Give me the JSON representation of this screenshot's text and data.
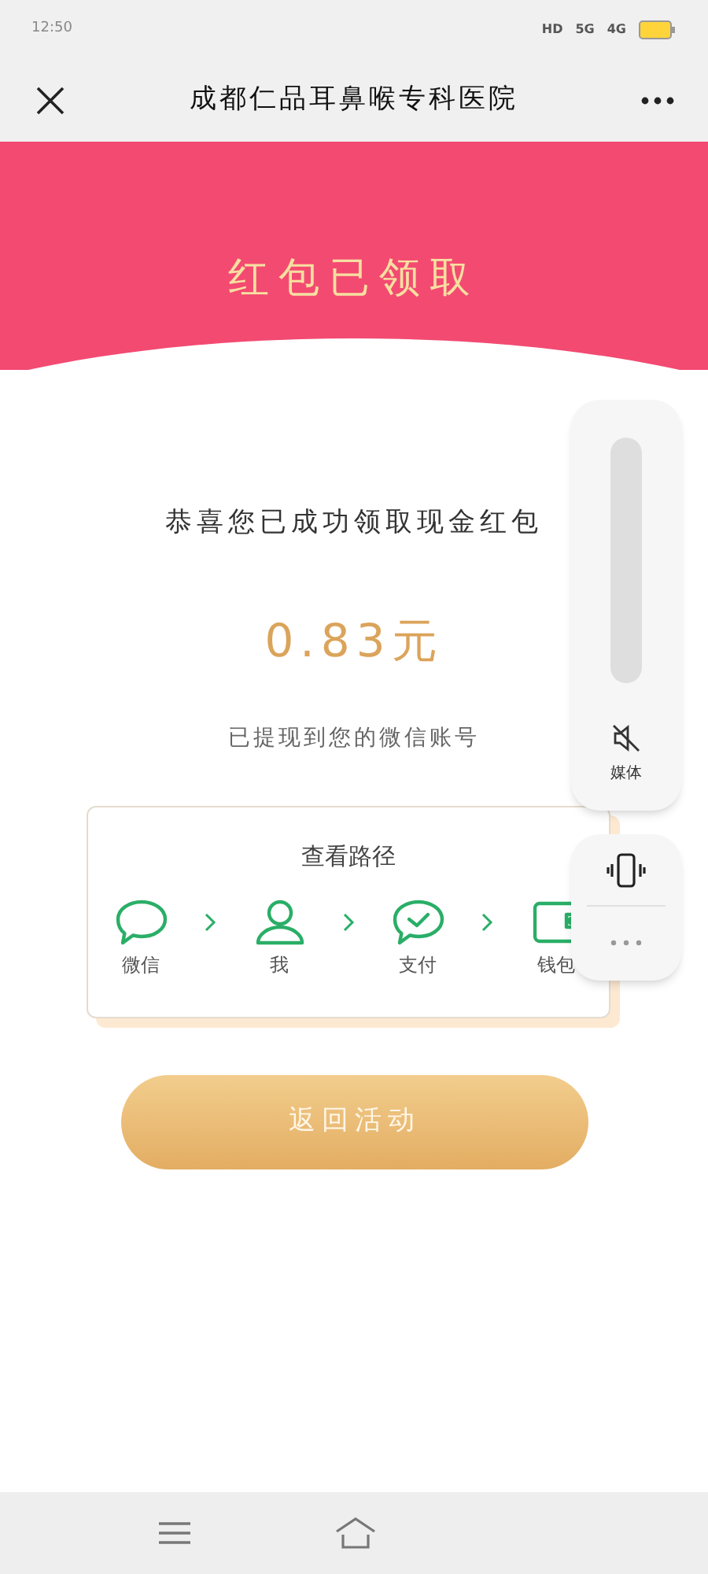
{
  "status_bar": {
    "time": "12:50",
    "network_labels": [
      "HD",
      "5G",
      "4G"
    ]
  },
  "title_bar": {
    "title": "成都仁品耳鼻喉专科医院"
  },
  "header": {
    "title": "红包已领取"
  },
  "result": {
    "message": "恭喜您已成功领取现金红包",
    "amount": "0.83元",
    "note": "已提现到您的微信账号"
  },
  "path_card": {
    "title": "查看路径",
    "steps": [
      {
        "kind": "chat",
        "label": "微信"
      },
      {
        "kind": "person",
        "label": "我"
      },
      {
        "kind": "pay",
        "label": "支付"
      },
      {
        "kind": "wallet",
        "label": "钱包"
      }
    ]
  },
  "back_button": {
    "label": "返回活动"
  },
  "volume_panel": {
    "level": 0,
    "muted": true,
    "label": "媒体"
  }
}
